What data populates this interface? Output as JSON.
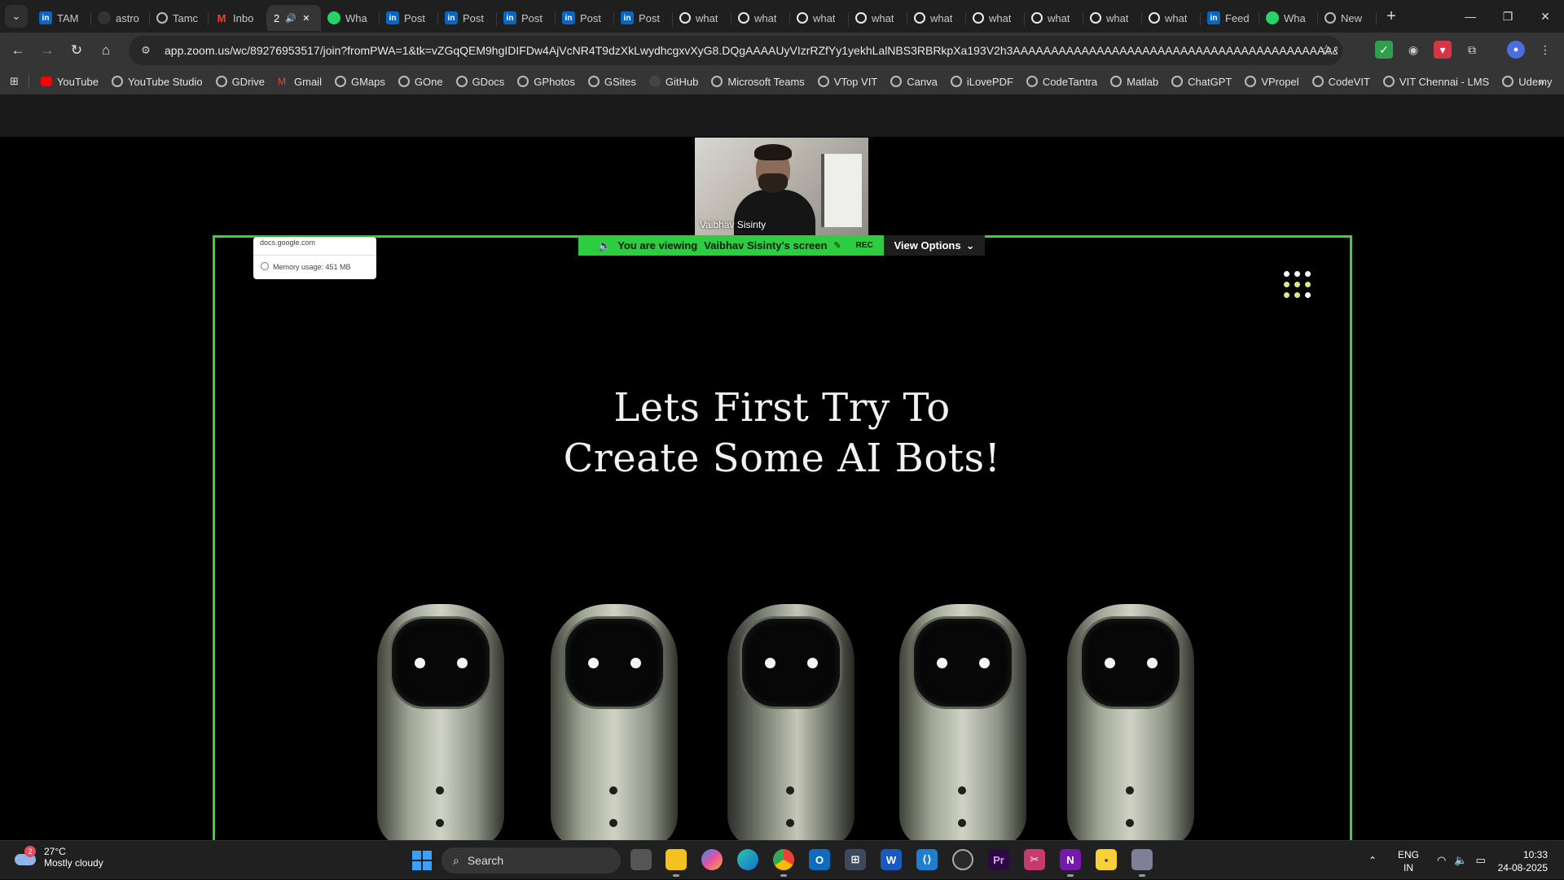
{
  "browser": {
    "tabs": [
      {
        "label": "TAM",
        "icon": "linkedin-icon"
      },
      {
        "label": "astro",
        "icon": "github-icon"
      },
      {
        "label": "Tamc",
        "icon": "chrome-icon"
      },
      {
        "label": "Inbo",
        "icon": "gmail-icon"
      },
      {
        "label": "2",
        "icon": "audio-icon",
        "active": true
      },
      {
        "label": "Wha",
        "icon": "whatsapp-icon"
      },
      {
        "label": "Post",
        "icon": "linkedin-icon"
      },
      {
        "label": "Post",
        "icon": "linkedin-icon"
      },
      {
        "label": "Post",
        "icon": "linkedin-icon"
      },
      {
        "label": "Post",
        "icon": "linkedin-icon"
      },
      {
        "label": "Post",
        "icon": "linkedin-icon"
      },
      {
        "label": "what",
        "icon": "google-icon"
      },
      {
        "label": "what",
        "icon": "google-icon"
      },
      {
        "label": "what",
        "icon": "google-icon"
      },
      {
        "label": "what",
        "icon": "google-icon"
      },
      {
        "label": "what",
        "icon": "google-icon"
      },
      {
        "label": "what",
        "icon": "google-icon"
      },
      {
        "label": "what",
        "icon": "google-icon"
      },
      {
        "label": "what",
        "icon": "google-icon"
      },
      {
        "label": "what",
        "icon": "google-icon"
      },
      {
        "label": "Feed",
        "icon": "linkedin-icon"
      },
      {
        "label": "Wha",
        "icon": "whatsapp-icon"
      },
      {
        "label": "New",
        "icon": "chrome-icon"
      }
    ],
    "url": "app.zoom.us/wc/89276953517/join?fromPWA=1&tk=vZGqQEM9hgIDIFDw4AjVcNR4T9dzXkLwydhcgxvXyG8.DQgAAAAUyVIzrRZfYy1yekhLalNBS3RBRkpXa193V2h3AAAAAAAAAAAAAAAAAAAAAAAAAAAAAAAAAAAAAAAAAA&_x_zm_r...",
    "bookmarks": [
      {
        "label": "YouTube",
        "icon": "youtube-icon"
      },
      {
        "label": "YouTube Studio",
        "icon": "globe-icon"
      },
      {
        "label": "GDrive",
        "icon": "globe-icon"
      },
      {
        "label": "Gmail",
        "icon": "gmail-icon"
      },
      {
        "label": "GMaps",
        "icon": "globe-icon"
      },
      {
        "label": "GOne",
        "icon": "globe-icon"
      },
      {
        "label": "GDocs",
        "icon": "globe-icon"
      },
      {
        "label": "GPhotos",
        "icon": "globe-icon"
      },
      {
        "label": "GSites",
        "icon": "globe-icon"
      },
      {
        "label": "GitHub",
        "icon": "github-icon"
      },
      {
        "label": "Microsoft Teams",
        "icon": "globe-icon"
      },
      {
        "label": "VTop VIT",
        "icon": "globe-icon"
      },
      {
        "label": "Canva",
        "icon": "globe-icon"
      },
      {
        "label": "iLovePDF",
        "icon": "globe-icon"
      },
      {
        "label": "CodeTantra",
        "icon": "globe-icon"
      },
      {
        "label": "Matlab",
        "icon": "globe-icon"
      },
      {
        "label": "ChatGPT",
        "icon": "openai-icon"
      },
      {
        "label": "VPropel",
        "icon": "globe-icon"
      },
      {
        "label": "CodeVIT",
        "icon": "globe-icon"
      },
      {
        "label": "VIT Chennai - LMS",
        "icon": "globe-icon"
      },
      {
        "label": "Udemy",
        "icon": "globe-icon"
      }
    ]
  },
  "zoom": {
    "participant_name": "Vaibhav Sisinty",
    "viewing_text": "You are viewing",
    "viewing_name": "Vaibhav Sisinty's screen",
    "rec_label": "REC",
    "view_options_label": "View Options",
    "share_border_color": "#3ad13a"
  },
  "shared_screen": {
    "tooltip_domain": "docs.google.com",
    "tooltip_memory": "Memory usage: 451 MB",
    "title_line1": "Lets First Try To",
    "title_line2": "Create Some AI Bots!"
  },
  "taskbar": {
    "weather_badge": "2",
    "temperature": "27°C",
    "condition": "Mostly cloudy",
    "search_placeholder": "Search",
    "lang_line1": "ENG",
    "lang_line2": "IN",
    "time": "10:33",
    "date": "24-08-2025"
  }
}
